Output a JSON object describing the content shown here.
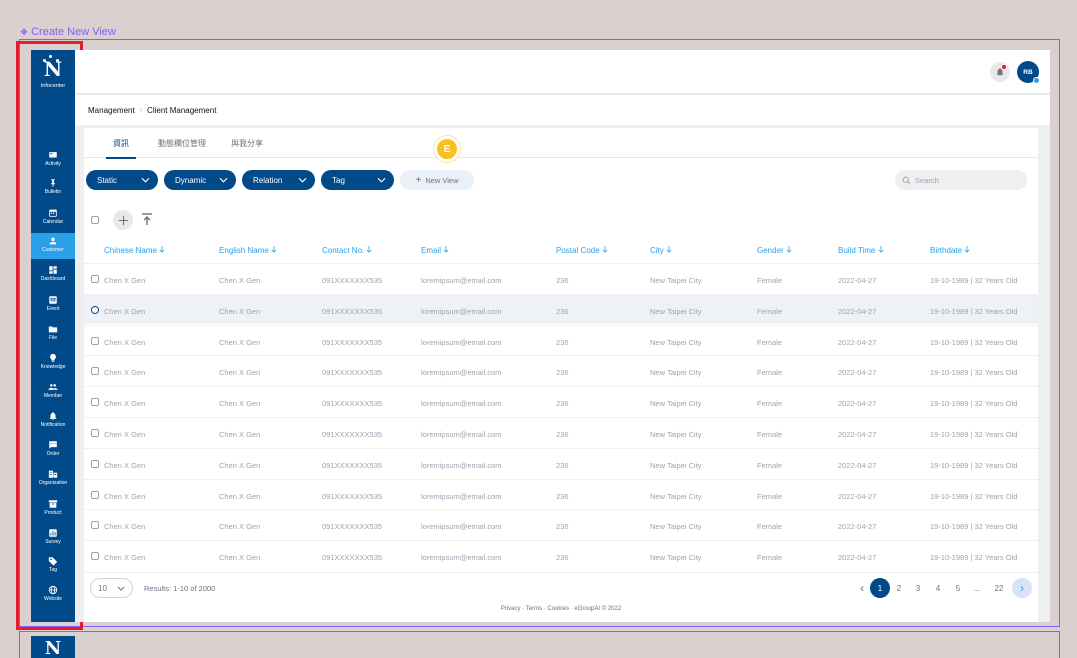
{
  "frame": {
    "label": "Create New View",
    "diamond": "❖"
  },
  "brand": {
    "letter": "N",
    "name": "Infocenter"
  },
  "sidebar": {
    "items": [
      {
        "label": "Activity",
        "icon": "activity-icon"
      },
      {
        "label": "Bulletin",
        "icon": "pin-icon"
      },
      {
        "label": "Calendar",
        "icon": "calendar-icon"
      },
      {
        "label": "Customer",
        "icon": "customer-icon",
        "active": true
      },
      {
        "label": "Dashboard",
        "icon": "dashboard-icon"
      },
      {
        "label": "Event",
        "icon": "event-icon"
      },
      {
        "label": "File",
        "icon": "folder-icon"
      },
      {
        "label": "Knowledge",
        "icon": "bulb-icon"
      },
      {
        "label": "Member",
        "icon": "member-icon"
      },
      {
        "label": "Notification",
        "icon": "bell-icon"
      },
      {
        "label": "Order",
        "icon": "chat-icon"
      },
      {
        "label": "Organization",
        "icon": "organization-icon"
      },
      {
        "label": "Product",
        "icon": "box-icon"
      },
      {
        "label": "Survey",
        "icon": "chart-icon"
      },
      {
        "label": "Tag",
        "icon": "tag-icon"
      },
      {
        "label": "Website",
        "icon": "globe-icon"
      }
    ]
  },
  "header": {
    "avatar_initials": "RB"
  },
  "breadcrumb": {
    "root": "Management",
    "separator": "›",
    "current": "Client Management"
  },
  "tabs": [
    "資訊",
    "動態欄位管理",
    "與我分享"
  ],
  "step_badge": "E",
  "filters": [
    "Static",
    "Dynamic",
    "Relation",
    "Tag"
  ],
  "new_view": {
    "plus": "+",
    "label": "New View"
  },
  "search": {
    "placeholder": "Search"
  },
  "columns": [
    "Chinese Name",
    "English  Name",
    "Contact No.",
    "Email",
    "Postal Code",
    "City",
    "Gender",
    "Build Time",
    "Birthdate"
  ],
  "rows": [
    [
      "Chen X Gen",
      "Chen X Gen",
      "091XXXXXXX535",
      "loremipsum@email.com",
      "236",
      "New Taipei City",
      "Female",
      "2022-04-27",
      "19-10-1989 | 32 Years Old"
    ],
    [
      "Chen X Gen",
      "Chen X Gen",
      "091XXXXXXX535",
      "loremipsum@email.com",
      "236",
      "New Taipei City",
      "Female",
      "2022-04-27",
      "19-10-1989 | 32 Years Old"
    ],
    [
      "Chen X Gen",
      "Chen X Gen",
      "091XXXXXXX535",
      "loremipsum@email.com",
      "236",
      "New Taipei City",
      "Female",
      "2022-04-27",
      "19-10-1989 | 32 Years Old"
    ],
    [
      "Chen X Gen",
      "Chen X Gen",
      "091XXXXXXX535",
      "loremipsum@email.com",
      "236",
      "New Taipei City",
      "Female",
      "2022-04-27",
      "19-10-1989 | 32 Years Old"
    ],
    [
      "Chen X Gen",
      "Chen X Gen",
      "091XXXXXXX535",
      "loremipsum@email.com",
      "236",
      "New Taipei City",
      "Female",
      "2022-04-27",
      "19-10-1989 | 32 Years Old"
    ],
    [
      "Chen X Gen",
      "Chen X Gen",
      "091XXXXXXX535",
      "loremipsum@email.com",
      "236",
      "New Taipei City",
      "Female",
      "2022-04-27",
      "19-10-1989 | 32 Years Old"
    ],
    [
      "Chen X Gen",
      "Chen X Gen",
      "091XXXXXXX535",
      "loremipsum@email.com",
      "236",
      "New Taipei City",
      "Female",
      "2022-04-27",
      "19-10-1989 | 32 Years Old"
    ],
    [
      "Chen X Gen",
      "Chen X Gen",
      "091XXXXXXX535",
      "loremipsum@email.com",
      "236",
      "New Taipei City",
      "Female",
      "2022-04-27",
      "19-10-1989 | 32 Years Old"
    ],
    [
      "Chen X Gen",
      "Chen X Gen",
      "091XXXXXXX535",
      "loremipsum@email.com",
      "236",
      "New Taipei City",
      "Female",
      "2022-04-27",
      "19-10-1989 | 32 Years Old"
    ],
    [
      "Chen X Gen",
      "Chen X Gen",
      "091XXXXXXX535",
      "loremipsum@email.com",
      "236",
      "New Taipei City",
      "Female",
      "2022-04-27",
      "19-10-1989 | 32 Years Old"
    ]
  ],
  "highlighted_row": 1,
  "pagination": {
    "per_page": "10",
    "results": "Results: 1-10 of 2000",
    "prev": "‹",
    "pages": [
      "1",
      "2",
      "3",
      "4",
      "5",
      "...",
      "22"
    ],
    "current": "1",
    "next": "›"
  },
  "footer": "Privacy · Terms · Cookies · eGroupAI © 2022",
  "colors": {
    "primary": "#004a8a",
    "accent": "#2aa0e8",
    "frame": "#8b5cf6",
    "highlight": "#e11d2e",
    "badge": "#fbbf24"
  }
}
